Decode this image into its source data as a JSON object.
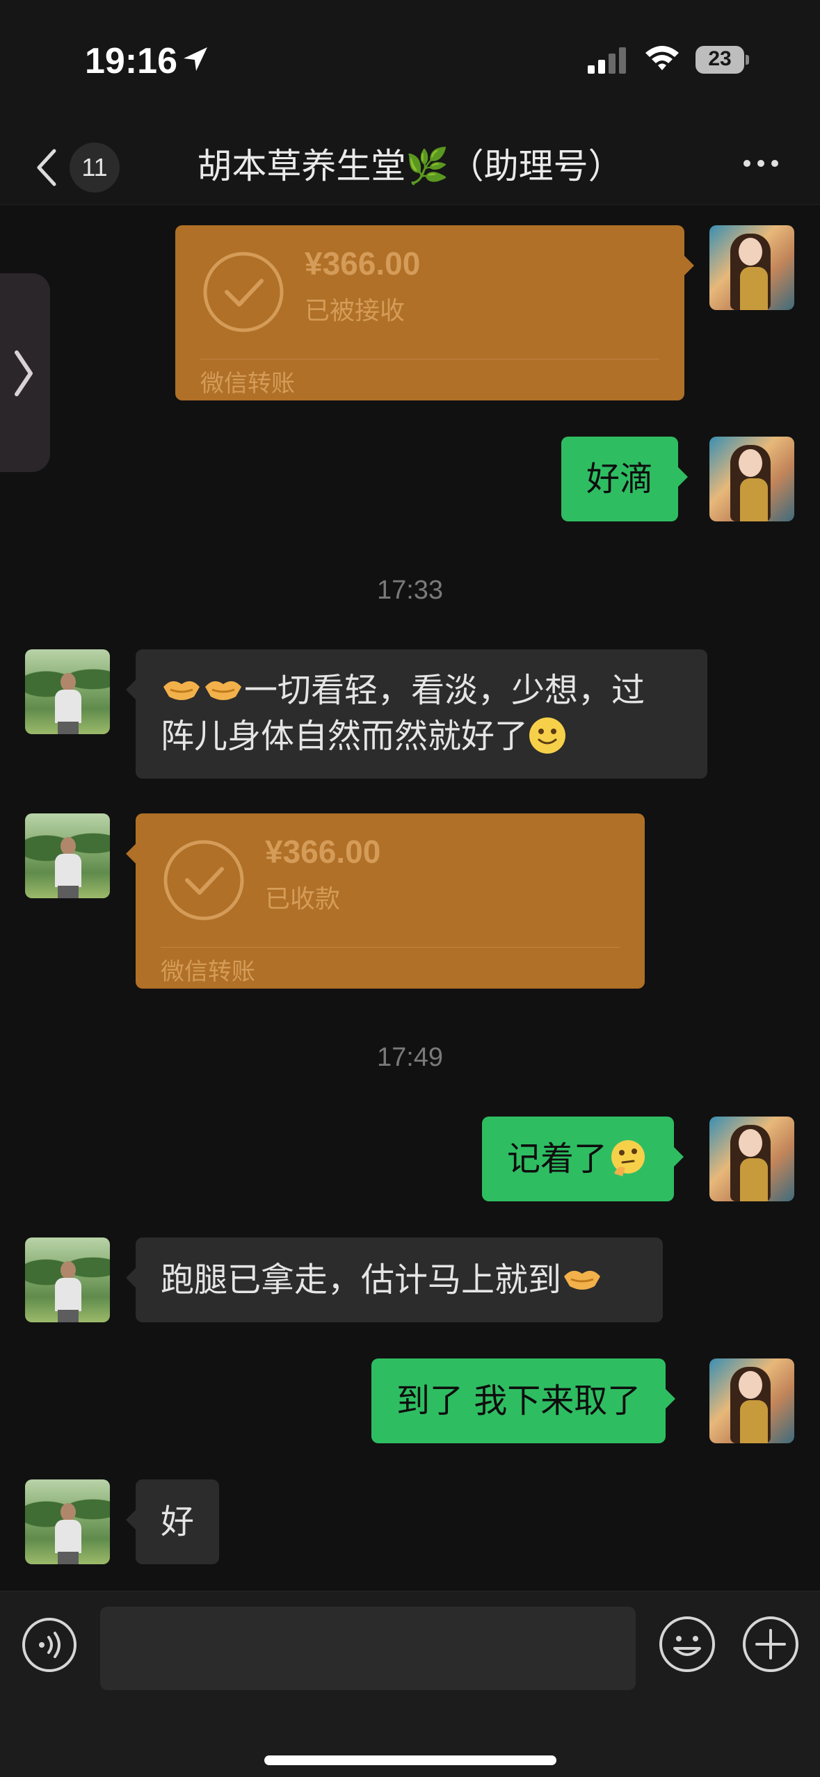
{
  "status_bar": {
    "time": "19:16",
    "battery": "23"
  },
  "nav": {
    "back_count": "11",
    "title": "胡本草养生堂🌿（助理号）"
  },
  "messages": [
    {
      "type": "transfer",
      "side": "right",
      "amount": "¥366.00",
      "status": "已被接收",
      "label": "微信转账"
    },
    {
      "type": "text",
      "side": "right",
      "text": "好滴"
    },
    {
      "type": "time",
      "text": "17:33"
    },
    {
      "type": "text",
      "side": "left",
      "line1": "一切看轻，看淡，少想，过",
      "line2": "阵儿身体自然而然就好了"
    },
    {
      "type": "transfer",
      "side": "left",
      "amount": "¥366.00",
      "status": "已收款",
      "label": "微信转账"
    },
    {
      "type": "time",
      "text": "17:49"
    },
    {
      "type": "text",
      "side": "right",
      "text": "记着了"
    },
    {
      "type": "text",
      "side": "left",
      "text": "跑腿已拿走，估计马上就到"
    },
    {
      "type": "text",
      "side": "right",
      "text": "到了 我下来取了"
    },
    {
      "type": "text",
      "side": "left",
      "text": "好"
    }
  ],
  "input": {
    "value": "",
    "placeholder": ""
  },
  "colors": {
    "background": "#111111",
    "bubble_self": "#2fbd62",
    "bubble_other": "#2c2c2c",
    "transfer_card": "#b07027"
  },
  "icons": [
    "location-arrow-icon",
    "signal-icon",
    "wifi-icon",
    "battery-icon",
    "back-chevron-icon",
    "more-icon",
    "side-chevron-icon",
    "check-circle-icon",
    "handshake-emoji",
    "smile-emoji",
    "thinking-emoji",
    "voice-icon",
    "emoji-icon",
    "plus-icon"
  ]
}
